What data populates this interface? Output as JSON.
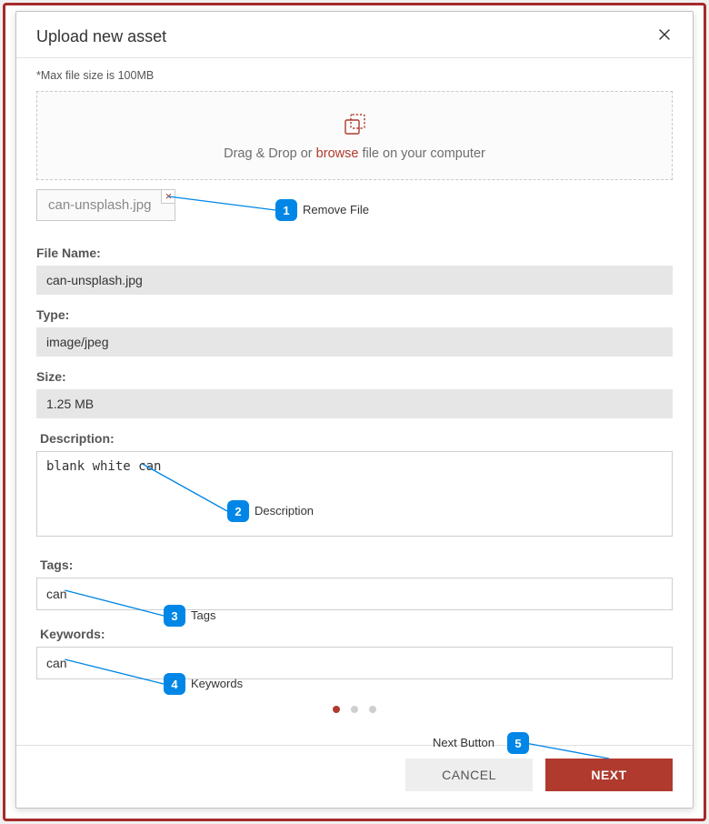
{
  "header": {
    "title": "Upload new asset"
  },
  "hint": "*Max file size is 100MB",
  "dropzone": {
    "prefix": "Drag & Drop or ",
    "browse": "browse",
    "suffix": " file on your computer"
  },
  "chip": {
    "filename": "can-unsplash.jpg"
  },
  "fields": {
    "fileNameLabel": "File Name:",
    "fileName": "can-unsplash.jpg",
    "typeLabel": "Type:",
    "type": "image/jpeg",
    "sizeLabel": "Size:",
    "size": "1.25 MB",
    "descLabel": "Description:",
    "desc": "blank white can",
    "tagsLabel": "Tags:",
    "tags": "can",
    "kwLabel": "Keywords:",
    "kw": "can"
  },
  "footer": {
    "cancel": "CANCEL",
    "next": "NEXT"
  },
  "ann": {
    "a1": "Remove File",
    "a2": "Description",
    "a3": "Tags",
    "a4": "Keywords",
    "a5": "Next Button"
  }
}
